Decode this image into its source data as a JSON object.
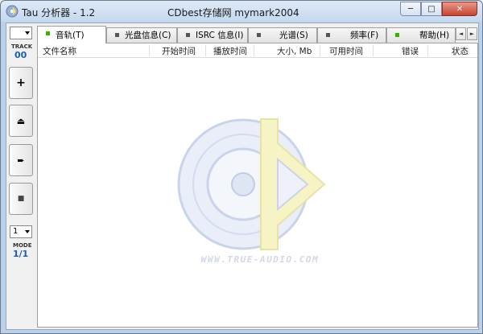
{
  "window": {
    "app_title": "Tau 分析器 - 1.2",
    "center_title": "CDbest存储网 mymark2004",
    "buttons": {
      "minimize": "─",
      "maximize": "□",
      "close": "✕"
    }
  },
  "leftbar": {
    "track_label": "TRACK",
    "track_value": "00",
    "buttons": [
      {
        "name": "add",
        "icon": "plus-icon",
        "glyph": "+"
      },
      {
        "name": "eject",
        "icon": "eject-icon",
        "glyph": "⏏"
      },
      {
        "name": "forward",
        "icon": "arrow-right-icon",
        "glyph": "➨"
      },
      {
        "name": "stop",
        "icon": "stop-icon",
        "glyph": "■"
      }
    ],
    "mode_select": "1",
    "mode_label": "MODE",
    "mode_value": "1/1"
  },
  "tabs": [
    {
      "label": "音轨(T)",
      "active": true,
      "indicator": "#3ab000"
    },
    {
      "label": "光盘信息(C)",
      "active": false,
      "indicator": "#555555"
    },
    {
      "label": "ISRC 信息(I)",
      "active": false,
      "indicator": "#555555"
    },
    {
      "label": "光谱(S)",
      "active": false,
      "indicator": "#555555"
    },
    {
      "label": "频率(F)",
      "active": false,
      "indicator": "#555555"
    },
    {
      "label": "帮助(H)",
      "active": false,
      "indicator": "#3ab000"
    }
  ],
  "tab_scroll": {
    "left": "◄",
    "right": "►"
  },
  "columns": [
    "文件名称",
    "开始时间",
    "播放时间",
    "大小, Mb",
    "可用时间",
    "错误",
    "状态"
  ],
  "watermark": {
    "text": "WWW.TRUE-AUDIO.COM"
  },
  "colors": {
    "accent": "#1a5fb4",
    "frame": "#b9d1ea",
    "logo_blue": "#c9d4ea",
    "logo_yellow": "#f6f3c4"
  }
}
